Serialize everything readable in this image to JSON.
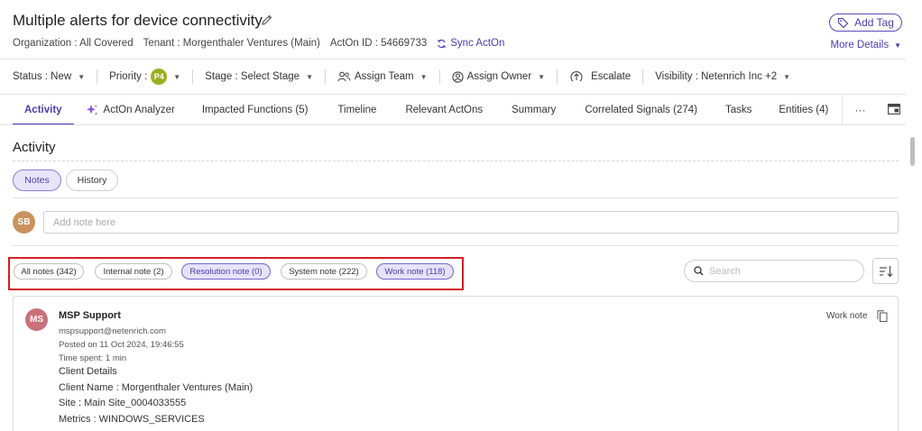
{
  "header": {
    "title": "Multiple alerts for device connectivity",
    "add_tag_label": "Add Tag",
    "organization": "Organization : All Covered",
    "tenant": "Tenant : Morgenthaler Ventures (Main)",
    "acton_id": "ActOn ID : 54669733",
    "sync_label": "Sync ActOn",
    "more_details_label": "More Details"
  },
  "toolbar": {
    "status": "Status : New",
    "priority_label": "Priority :",
    "priority_badge": "P4",
    "priority_color": "#9aaf1f",
    "stage": "Stage : Select Stage",
    "assign_team": "Assign Team",
    "assign_owner": "Assign Owner",
    "escalate": "Escalate",
    "visibility": "Visibility : Netenrich Inc +2"
  },
  "tabs": [
    {
      "label": "Activity",
      "active": true
    },
    {
      "label": "ActOn Analyzer",
      "active": false
    },
    {
      "label": "Impacted Functions (5)",
      "active": false
    },
    {
      "label": "Timeline",
      "active": false
    },
    {
      "label": "Relevant ActOns",
      "active": false
    },
    {
      "label": "Summary",
      "active": false
    },
    {
      "label": "Correlated Signals (274)",
      "active": false
    },
    {
      "label": "Tasks",
      "active": false
    },
    {
      "label": "Entities (4)",
      "active": false
    }
  ],
  "tabs_more_label": "···",
  "activity": {
    "heading": "Activity",
    "notes_toggle": "Notes",
    "history_toggle": "History",
    "user_initials": "SB",
    "note_placeholder": "Add note here",
    "filters": [
      {
        "label": "All notes (342)",
        "selected": false
      },
      {
        "label": "Internal note (2)",
        "selected": false
      },
      {
        "label": "Resolution note (0)",
        "selected": true
      },
      {
        "label": "System note (222)",
        "selected": false
      },
      {
        "label": "Work note (118)",
        "selected": true
      }
    ],
    "search_placeholder": "Search"
  },
  "note": {
    "initials": "MS",
    "author": "MSP Support",
    "email": "mspsupport@netenrich.com",
    "posted": "Posted on 11 Oct 2024, 19:46:55",
    "time_spent": "Time spent: 1 min",
    "type": "Work note",
    "lines": [
      "Client Details",
      "Client Name : Morgenthaler Ventures (Main)",
      "Site : Main Site_0004033555",
      "Metrics : WINDOWS_SERVICES"
    ]
  },
  "colors": {
    "accent": "#4a3dab",
    "highlight_box": "#d11f25",
    "user_avatar": "#c9925e",
    "note_avatar": "#c9707a"
  }
}
